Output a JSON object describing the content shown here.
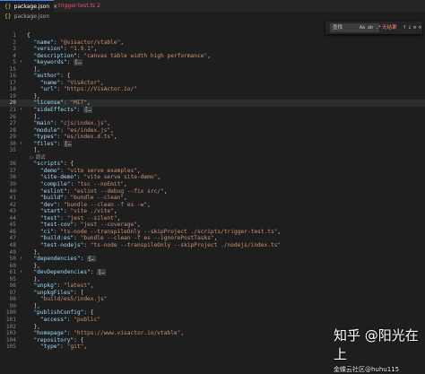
{
  "tabs": [
    {
      "icon": "{}",
      "label": "package.json",
      "close": "×"
    },
    {
      "icon": "TS",
      "label": "trigger-test.ts",
      "badge": "2"
    }
  ],
  "breadcrumb": {
    "icon": "{}",
    "label": "package.json"
  },
  "find": {
    "placeholder": "查找",
    "options": "Aa ab .*",
    "result": "无结果",
    "nav": "↑ ↓ ≡ ×"
  },
  "watermark": {
    "main": "知乎 @阳光在上",
    "sub": "金蝶云社区@huhu115"
  },
  "lines": [
    {
      "n": "1",
      "c": [
        [
          "p",
          "{"
        ]
      ]
    },
    {
      "n": "2",
      "c": [
        [
          "p",
          "  "
        ],
        [
          "k",
          "\"name\""
        ],
        [
          "p",
          ": "
        ],
        [
          "s",
          "\"@visactor/vtable\""
        ],
        [
          "p",
          ","
        ]
      ]
    },
    {
      "n": "3",
      "c": [
        [
          "p",
          "  "
        ],
        [
          "k",
          "\"version\""
        ],
        [
          "p",
          ": "
        ],
        [
          "s",
          "\"1.9.1\""
        ],
        [
          "p",
          ","
        ]
      ]
    },
    {
      "n": "4",
      "c": [
        [
          "p",
          "  "
        ],
        [
          "k",
          "\"description\""
        ],
        [
          "p",
          ": "
        ],
        [
          "s",
          "\"canvas table width high performance\""
        ],
        [
          "p",
          ","
        ]
      ]
    },
    {
      "n": "5",
      "chev": "›",
      "c": [
        [
          "p",
          "  "
        ],
        [
          "k",
          "\"keywords\""
        ],
        [
          "p",
          ": "
        ],
        [
          "fold",
          "[…"
        ]
      ]
    },
    {
      "n": "15",
      "c": [
        [
          "p",
          "  ],"
        ]
      ]
    },
    {
      "n": "16",
      "c": [
        [
          "p",
          "  "
        ],
        [
          "k",
          "\"author\""
        ],
        [
          "p",
          ": {"
        ]
      ]
    },
    {
      "n": "17",
      "c": [
        [
          "p",
          "    "
        ],
        [
          "k",
          "\"name\""
        ],
        [
          "p",
          ": "
        ],
        [
          "s",
          "\"VisActor\""
        ],
        [
          "p",
          ","
        ]
      ]
    },
    {
      "n": "18",
      "c": [
        [
          "p",
          "    "
        ],
        [
          "k",
          "\"url\""
        ],
        [
          "p",
          ": "
        ],
        [
          "s",
          "\"https://VisActor.io/\""
        ]
      ]
    },
    {
      "n": "19",
      "c": [
        [
          "p",
          "  },"
        ]
      ]
    },
    {
      "n": "20",
      "c": [
        [
          "p",
          "  "
        ],
        [
          "k",
          "\"license\""
        ],
        [
          "p",
          ": "
        ],
        [
          "s",
          "\"MIT\""
        ],
        [
          "p",
          ","
        ]
      ]
    },
    {
      "n": "21",
      "chev": "›",
      "c": [
        [
          "p",
          "  "
        ],
        [
          "k",
          "\"sideEffects\""
        ],
        [
          "p",
          ": "
        ],
        [
          "fold",
          "[…"
        ]
      ]
    },
    {
      "n": "26",
      "c": [
        [
          "p",
          "  ],"
        ]
      ]
    },
    {
      "n": "27",
      "c": [
        [
          "p",
          "  "
        ],
        [
          "k",
          "\"main\""
        ],
        [
          "p",
          ": "
        ],
        [
          "s",
          "\"cjs/index.js\""
        ],
        [
          "p",
          ","
        ]
      ]
    },
    {
      "n": "28",
      "c": [
        [
          "p",
          "  "
        ],
        [
          "k",
          "\"module\""
        ],
        [
          "p",
          ": "
        ],
        [
          "s",
          "\"es/index.js\""
        ],
        [
          "p",
          ","
        ]
      ]
    },
    {
      "n": "29",
      "c": [
        [
          "p",
          "  "
        ],
        [
          "k",
          "\"types\""
        ],
        [
          "p",
          ": "
        ],
        [
          "s",
          "\"es/index.d.ts\""
        ],
        [
          "p",
          ","
        ]
      ]
    },
    {
      "n": "30",
      "chev": "›",
      "c": [
        [
          "p",
          "  "
        ],
        [
          "k",
          "\"files\""
        ],
        [
          "p",
          ": "
        ],
        [
          "fold",
          "[…"
        ]
      ]
    },
    {
      "n": "35",
      "c": [
        [
          "p",
          "  ],"
        ]
      ]
    },
    {
      "n": "",
      "c": [
        [
          "lens",
          "  ▷ 调试"
        ]
      ]
    },
    {
      "n": "36",
      "c": [
        [
          "p",
          "  "
        ],
        [
          "k",
          "\"scripts\""
        ],
        [
          "p",
          ": {"
        ]
      ]
    },
    {
      "n": "37",
      "c": [
        [
          "p",
          "    "
        ],
        [
          "k",
          "\"demo\""
        ],
        [
          "p",
          ": "
        ],
        [
          "s",
          "\"vite serve examples\""
        ],
        [
          "p",
          ","
        ]
      ]
    },
    {
      "n": "38",
      "c": [
        [
          "p",
          "    "
        ],
        [
          "k",
          "\"site-demo\""
        ],
        [
          "p",
          ": "
        ],
        [
          "s",
          "\"vite serve site-demo\""
        ],
        [
          "p",
          ","
        ]
      ]
    },
    {
      "n": "39",
      "c": [
        [
          "p",
          "    "
        ],
        [
          "k",
          "\"compile\""
        ],
        [
          "p",
          ": "
        ],
        [
          "s",
          "\"tsc --noEmit\""
        ],
        [
          "p",
          ","
        ]
      ]
    },
    {
      "n": "40",
      "c": [
        [
          "p",
          "    "
        ],
        [
          "k",
          "\"eslint\""
        ],
        [
          "p",
          ": "
        ],
        [
          "s",
          "\"eslint --debug --fix src/\""
        ],
        [
          "p",
          ","
        ]
      ]
    },
    {
      "n": "41",
      "c": [
        [
          "p",
          "    "
        ],
        [
          "k",
          "\"build\""
        ],
        [
          "p",
          ": "
        ],
        [
          "s",
          "\"bundle --clean\""
        ],
        [
          "p",
          ","
        ]
      ]
    },
    {
      "n": "42",
      "c": [
        [
          "p",
          "    "
        ],
        [
          "k",
          "\"dev\""
        ],
        [
          "p",
          ": "
        ],
        [
          "s",
          "\"bundle --clean -f es -w\""
        ],
        [
          "p",
          ","
        ]
      ]
    },
    {
      "n": "43",
      "c": [
        [
          "p",
          "    "
        ],
        [
          "k",
          "\"start\""
        ],
        [
          "p",
          ": "
        ],
        [
          "s",
          "\"vite ./vite\""
        ],
        [
          "p",
          ","
        ]
      ]
    },
    {
      "n": "44",
      "c": [
        [
          "p",
          "    "
        ],
        [
          "k",
          "\"test\""
        ],
        [
          "p",
          ": "
        ],
        [
          "s",
          "\"jest --silent\""
        ],
        [
          "p",
          ","
        ]
      ]
    },
    {
      "n": "45",
      "c": [
        [
          "p",
          "    "
        ],
        [
          "k",
          "\"test-cov\""
        ],
        [
          "p",
          ": "
        ],
        [
          "s",
          "\"jest --coverage\""
        ],
        [
          "p",
          ","
        ]
      ]
    },
    {
      "n": "46",
      "c": [
        [
          "p",
          "    "
        ],
        [
          "k",
          "\"ci\""
        ],
        [
          "p",
          ": "
        ],
        [
          "s",
          "\"ts-node --transpileOnly --skipProject ./scripts/trigger-test.ts\""
        ],
        [
          "p",
          ","
        ]
      ]
    },
    {
      "n": "47",
      "c": [
        [
          "p",
          "    "
        ],
        [
          "k",
          "\"build:es\""
        ],
        [
          "p",
          ": "
        ],
        [
          "s",
          "\"bundle --clean -f es --ignorePostTasks\""
        ],
        [
          "p",
          ","
        ]
      ]
    },
    {
      "n": "48",
      "c": [
        [
          "p",
          "    "
        ],
        [
          "k",
          "\"test-nodejs\""
        ],
        [
          "p",
          ": "
        ],
        [
          "s",
          "\"ts-node --transpileOnly --skipProject ./nodejs/index.ts\""
        ]
      ]
    },
    {
      "n": "49",
      "c": [
        [
          "p",
          "  },"
        ]
      ]
    },
    {
      "n": "50",
      "chev": "›",
      "c": [
        [
          "p",
          "  "
        ],
        [
          "k",
          "\"dependencies\""
        ],
        [
          "p",
          ": "
        ],
        [
          "fold",
          "{…"
        ]
      ]
    },
    {
      "n": "60",
      "c": [
        [
          "p",
          "  },"
        ]
      ]
    },
    {
      "n": "61",
      "chev": "›",
      "c": [
        [
          "p",
          "  "
        ],
        [
          "k",
          "\"devDependencies\""
        ],
        [
          "p",
          ": "
        ],
        [
          "fold",
          "{…"
        ]
      ]
    },
    {
      "n": "95",
      "c": [
        [
          "p",
          "  },"
        ]
      ]
    },
    {
      "n": "96",
      "c": [
        [
          "p",
          "  "
        ],
        [
          "k",
          "\"unpkg\""
        ],
        [
          "p",
          ": "
        ],
        [
          "s",
          "\"latest\""
        ],
        [
          "p",
          ","
        ]
      ]
    },
    {
      "n": "97",
      "c": [
        [
          "p",
          "  "
        ],
        [
          "k",
          "\"unpkgFiles\""
        ],
        [
          "p",
          ": ["
        ]
      ]
    },
    {
      "n": "98",
      "c": [
        [
          "p",
          "    "
        ],
        [
          "s",
          "\"build/es5/index.js\""
        ]
      ]
    },
    {
      "n": "99",
      "c": [
        [
          "p",
          "  ],"
        ]
      ]
    },
    {
      "n": "100",
      "c": [
        [
          "p",
          "  "
        ],
        [
          "k",
          "\"publishConfig\""
        ],
        [
          "p",
          ": {"
        ]
      ]
    },
    {
      "n": "101",
      "c": [
        [
          "p",
          "    "
        ],
        [
          "k",
          "\"access\""
        ],
        [
          "p",
          ": "
        ],
        [
          "s",
          "\"public\""
        ]
      ]
    },
    {
      "n": "102",
      "c": [
        [
          "p",
          "  },"
        ]
      ]
    },
    {
      "n": "103",
      "c": [
        [
          "p",
          "  "
        ],
        [
          "k",
          "\"homepage\""
        ],
        [
          "p",
          ": "
        ],
        [
          "s",
          "\"https://www.visactor.io/vtable\""
        ],
        [
          "p",
          ","
        ]
      ]
    },
    {
      "n": "104",
      "c": [
        [
          "p",
          "  "
        ],
        [
          "k",
          "\"repository\""
        ],
        [
          "p",
          ": {"
        ]
      ]
    },
    {
      "n": "105",
      "c": [
        [
          "p",
          "    "
        ],
        [
          "k",
          "\"type\""
        ],
        [
          "p",
          ": "
        ],
        [
          "s",
          "\"git\""
        ],
        [
          "p",
          ","
        ]
      ]
    }
  ]
}
